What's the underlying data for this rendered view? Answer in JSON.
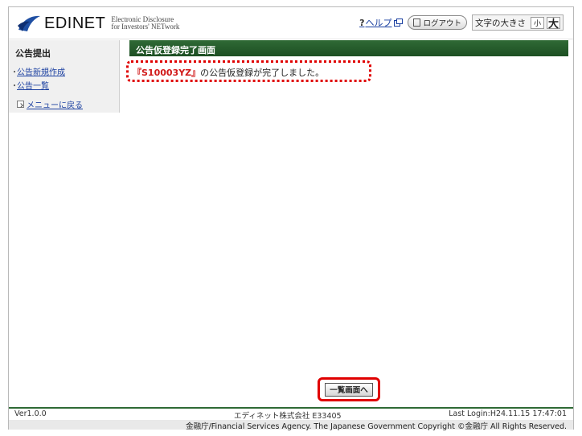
{
  "header": {
    "brand": "EDINET",
    "brand_sub_line1": "Electronic Disclosure",
    "brand_sub_line2": "for Investors' NETwork",
    "help_q": "?",
    "help_label": "ヘルプ",
    "logout_label": "ログアウト",
    "fontsize_label": "文字の大きさ",
    "fontsize_small": "小",
    "fontsize_large": "大"
  },
  "sidebar": {
    "title": "公告提出",
    "items": [
      {
        "label": "公告新規作成"
      },
      {
        "label": "公告一覧"
      }
    ],
    "back_label": "メニューに戻る"
  },
  "main": {
    "title": "公告仮登録完了画面",
    "message_id": "『S10003YZ』",
    "message_rest": "の公告仮登録が完了しました。",
    "list_button": "一覧画面へ"
  },
  "footer": {
    "version": "Ver1.0.0",
    "company": "エディネット株式会社 E33405",
    "last_login": "Last Login:H24.11.15 17:47:01",
    "copyright": "金融庁/Financial Services Agency. The Japanese Government Copyright ©金融庁 All Rights Reserved."
  },
  "colors": {
    "accent_green": "#2f6a35",
    "highlight_red": "#e00000",
    "link_blue": "#1a3fa0"
  }
}
